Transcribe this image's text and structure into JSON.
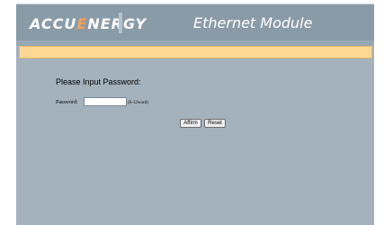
{
  "header": {
    "logo_main": "ACCU",
    "logo_accent": "E",
    "logo_rest": "NERGY",
    "title": "Ethernet Module"
  },
  "status_bar": {
    "message": ""
  },
  "login": {
    "prompt": "Please Input Password:",
    "password_label": "Password:",
    "password_value": "",
    "password_hint": "(6-12word)",
    "affirm_label": "Affirm",
    "reset_label": "Reset"
  },
  "colors": {
    "page_background": "#ffffff",
    "frame_background": "#a3b2bd",
    "header_background": "#8a9ba8",
    "status_bar_background": "#fdd894",
    "logo_accent": "#f4a259"
  }
}
